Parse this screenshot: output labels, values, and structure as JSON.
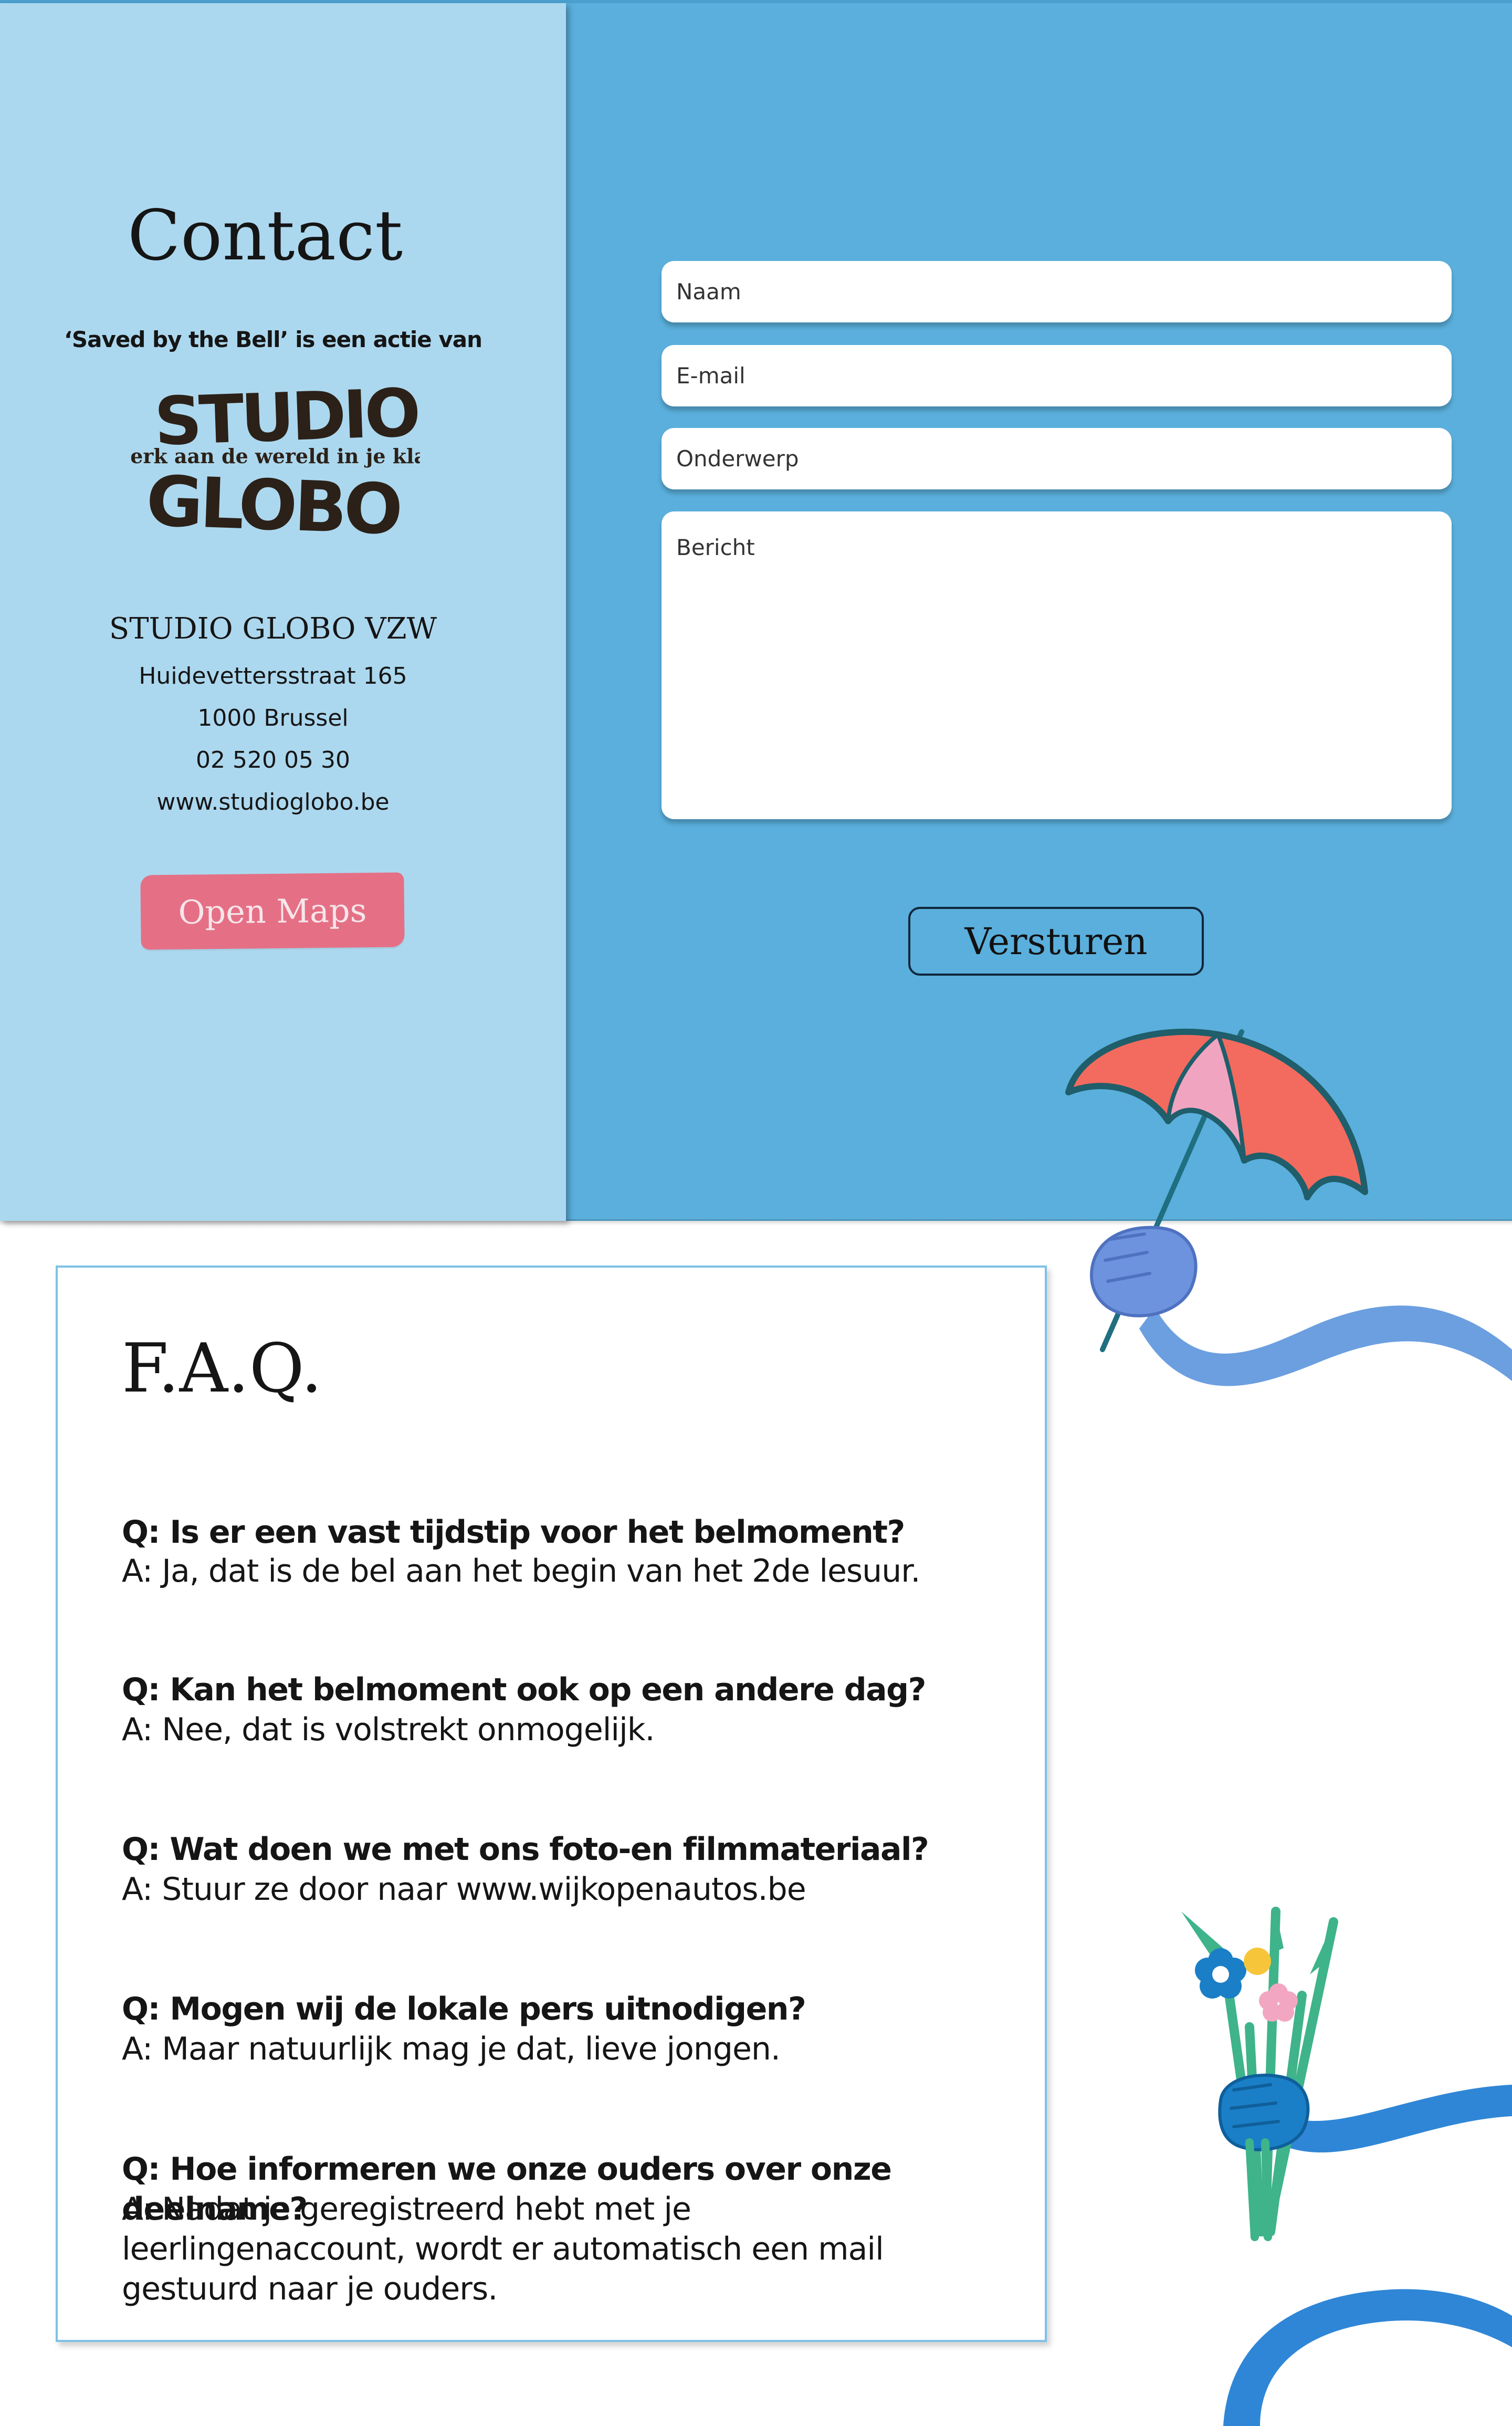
{
  "contact": {
    "title": "Contact",
    "action_line": "‘Saved by the Bell’ is een actie van",
    "logo": {
      "line1": "STUDIO",
      "tagline": "werk aan de wereld in je klas",
      "line2": "GLOBO"
    },
    "org_name": "STUDIO GLOBO VZW",
    "address_street": "Huidevettersstraat 165",
    "address_city": "1000 Brussel",
    "phone": "02 520 05 30",
    "website": "www.studioglobo.be",
    "maps_button": "Open Maps"
  },
  "form": {
    "name_placeholder": "Naam",
    "email_placeholder": "E-mail",
    "subject_placeholder": "Onderwerp",
    "message_placeholder": "Bericht",
    "send_button": "Versturen"
  },
  "faq": {
    "title": "F.A.Q.",
    "items": [
      {
        "q": "Q: Is er een vast tijdstip voor het belmoment?",
        "a": "A: Ja, dat is de bel aan het begin van het 2de lesuur."
      },
      {
        "q": "Q: Kan het belmoment ook op een andere dag?",
        "a": "A: Nee, dat is volstrekt onmogelijk."
      },
      {
        "q": "Q: Wat doen we met ons foto-en filmmateriaal?",
        "a": "A: Stuur ze door naar www.wijkopenautos.be"
      },
      {
        "q": "Q: Mogen wij de lokale pers uitnodigen?",
        "a": "A: Maar natuurlijk mag je dat, lieve jongen."
      },
      {
        "q": "Q: Hoe informeren we onze ouders over onze deelname?",
        "a": "A: Nadat je geregistreerd hebt met je leerlingenaccount, wordt er automatisch een mail gestuurd naar je ouders."
      }
    ]
  },
  "colors": {
    "left_panel": "#acd8ef",
    "right_panel": "#5aafdc",
    "maps_button": "#e57086",
    "logo_dark": "#2b2118",
    "umbrella_red": "#f36b5e",
    "umbrella_pink": "#f1a4c0",
    "arm_blue": "#2f86d6"
  },
  "icons": [
    "umbrella-icon",
    "hand-holding-umbrella-icon",
    "flower-bouquet-icon",
    "hand-holding-flowers-icon"
  ]
}
